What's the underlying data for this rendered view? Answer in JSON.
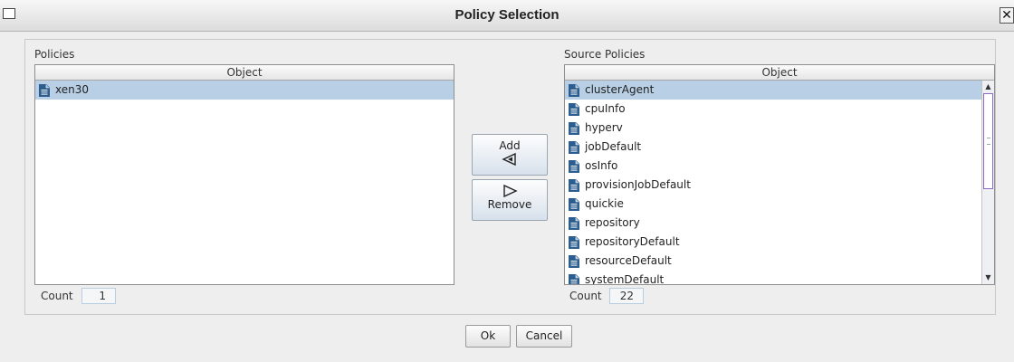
{
  "window": {
    "title": "Policy Selection",
    "close_glyph": "✕"
  },
  "policies": {
    "label": "Policies",
    "column_header": "Object",
    "items": [
      {
        "name": "xen30",
        "selected": true,
        "icon": "document-icon"
      }
    ],
    "count_label": "Count",
    "count_value": "1"
  },
  "source_policies": {
    "label": "Source Policies",
    "column_header": "Object",
    "items": [
      {
        "name": "clusterAgent",
        "selected": true,
        "icon": "document-icon"
      },
      {
        "name": "cpuInfo",
        "icon": "document-icon"
      },
      {
        "name": "hyperv",
        "icon": "document-icon"
      },
      {
        "name": "jobDefault",
        "icon": "document-icon"
      },
      {
        "name": "osInfo",
        "icon": "document-icon"
      },
      {
        "name": "provisionJobDefault",
        "icon": "document-icon"
      },
      {
        "name": "quickie",
        "icon": "document-icon"
      },
      {
        "name": "repository",
        "icon": "document-icon"
      },
      {
        "name": "repositoryDefault",
        "icon": "document-icon"
      },
      {
        "name": "resourceDefault",
        "icon": "document-icon"
      },
      {
        "name": "systemDefault",
        "icon": "document-icon"
      }
    ],
    "count_label": "Count",
    "count_value": "22"
  },
  "transfer": {
    "add_label": "Add",
    "remove_label": "Remove"
  },
  "dialog_buttons": {
    "ok_label": "Ok",
    "cancel_label": "Cancel"
  },
  "colors": {
    "selection": "#b8cfe5",
    "icon_blue": "#2c5d8f",
    "scroll_thumb_border": "#8a6cc8"
  }
}
